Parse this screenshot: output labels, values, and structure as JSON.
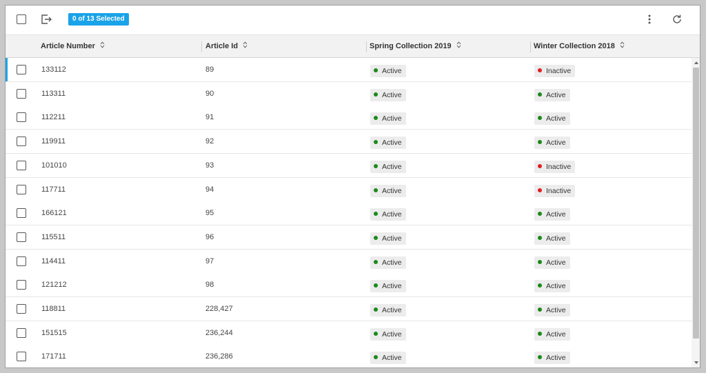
{
  "toolbar": {
    "selection_badge": "0 of 13 Selected"
  },
  "columns": [
    {
      "label": "Article Number"
    },
    {
      "label": "Article Id"
    },
    {
      "label": "Spring Collection 2019"
    },
    {
      "label": "Winter Collection 2018"
    }
  ],
  "colors": {
    "accent": "#1aa3e8",
    "active_dot": "#1a8a1a",
    "inactive_dot": "#e02020"
  },
  "rows": [
    {
      "article_number": "133112",
      "article_id": "89",
      "spring": "Active",
      "winter": "Inactive"
    },
    {
      "article_number": "113311",
      "article_id": "90",
      "spring": "Active",
      "winter": "Active"
    },
    {
      "article_number": "112211",
      "article_id": "91",
      "spring": "Active",
      "winter": "Active"
    },
    {
      "article_number": "119911",
      "article_id": "92",
      "spring": "Active",
      "winter": "Active"
    },
    {
      "article_number": "101010",
      "article_id": "93",
      "spring": "Active",
      "winter": "Inactive"
    },
    {
      "article_number": "117711",
      "article_id": "94",
      "spring": "Active",
      "winter": "Inactive"
    },
    {
      "article_number": "166121",
      "article_id": "95",
      "spring": "Active",
      "winter": "Active"
    },
    {
      "article_number": "115511",
      "article_id": "96",
      "spring": "Active",
      "winter": "Active"
    },
    {
      "article_number": "114411",
      "article_id": "97",
      "spring": "Active",
      "winter": "Active"
    },
    {
      "article_number": "121212",
      "article_id": "98",
      "spring": "Active",
      "winter": "Active"
    },
    {
      "article_number": "118811",
      "article_id": "228,427",
      "spring": "Active",
      "winter": "Active"
    },
    {
      "article_number": "151515",
      "article_id": "236,244",
      "spring": "Active",
      "winter": "Active"
    },
    {
      "article_number": "171711",
      "article_id": "236,286",
      "spring": "Active",
      "winter": "Active"
    }
  ]
}
